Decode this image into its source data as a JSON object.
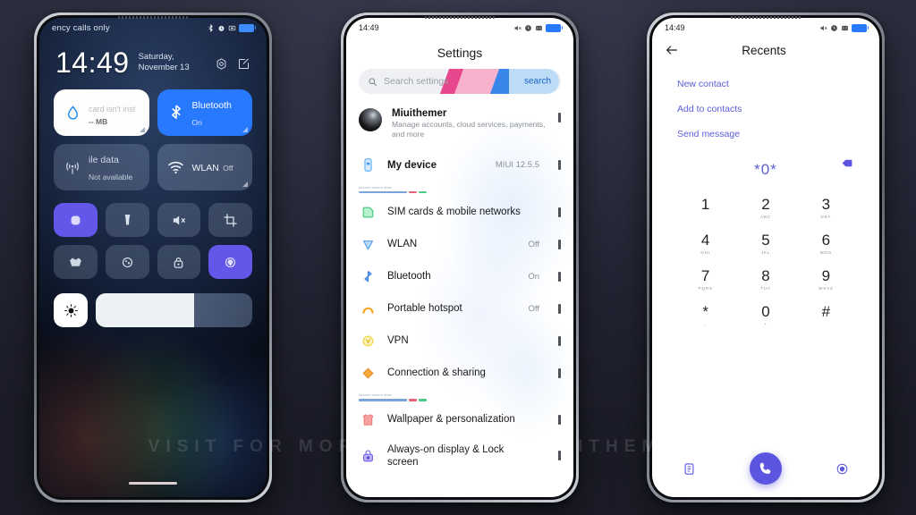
{
  "background_color": "#2a2b3c",
  "watermark": "VISIT FOR MORE THEMES - MIUITHEMER.COM",
  "phone1": {
    "name": "control-center",
    "statusbar": {
      "carrier": "ency calls only",
      "icons": [
        "bluetooth-icon",
        "alarm-icon",
        "silent-icon",
        "battery-icon"
      ]
    },
    "clock": {
      "time": "14:49",
      "date": "Saturday, November 13"
    },
    "clock_actions": [
      "settings-gear-icon",
      "edit-icon"
    ],
    "big_tiles": [
      {
        "title": "card isn't inst",
        "sub": "-- MB",
        "icon": "data-usage-drop-icon",
        "state": "white"
      },
      {
        "title": "Bluetooth",
        "sub": "On",
        "icon": "bluetooth-icon",
        "state": "on"
      },
      {
        "title": "ile data",
        "sub": "Not available",
        "icon": "mobile-signal-icon",
        "state": "off"
      },
      {
        "title": "WLAN",
        "sub": "Off",
        "icon": "wifi-icon",
        "state": "off"
      }
    ],
    "small_tiles": [
      {
        "icon": "dnd-icon",
        "on": true
      },
      {
        "icon": "flashlight-icon",
        "on": false
      },
      {
        "icon": "mute-icon",
        "on": false
      },
      {
        "icon": "screenshot-icon",
        "on": false
      },
      {
        "icon": "reading-mode-icon",
        "on": false
      },
      {
        "icon": "ultra-battery-icon",
        "on": false
      },
      {
        "icon": "lock-icon",
        "on": false
      },
      {
        "icon": "location-icon",
        "on": true
      }
    ],
    "brightness": {
      "icon": "auto-brightness-icon",
      "level_percent": 63
    }
  },
  "phone2": {
    "name": "settings",
    "statusbar": {
      "time": "14:49",
      "icons": [
        "silent-icon",
        "alarm-icon",
        "screenshot-icon",
        "battery-icon"
      ]
    },
    "title": "Settings",
    "search": {
      "placeholder": "Search settings",
      "icon": "search-icon",
      "badge": "search"
    },
    "account": {
      "name": "Miuithemer",
      "subtitle": "Manage accounts, cloud services, payments, and more",
      "avatar": "user-avatar"
    },
    "items": [
      {
        "label": "My device",
        "value": "MIUI 12.5.5",
        "icon": "phone-device-icon",
        "color": "#4ba3f5"
      },
      {
        "section": true,
        "label": "Internet secure ation"
      },
      {
        "label": "SIM cards & mobile networks",
        "value": "",
        "icon": "sim-card-icon",
        "color": "#44d07b"
      },
      {
        "label": "WLAN",
        "value": "Off",
        "icon": "wifi-shield-icon",
        "color": "#55a8f0"
      },
      {
        "label": "Bluetooth",
        "value": "On",
        "icon": "bluetooth-icon",
        "color": "#4a90f0"
      },
      {
        "label": "Portable hotspot",
        "value": "Off",
        "icon": "hotspot-icon",
        "color": "#f5a623"
      },
      {
        "label": "VPN",
        "value": "",
        "icon": "vpn-icon",
        "color": "#f2d13b"
      },
      {
        "label": "Connection & sharing",
        "value": "",
        "icon": "connection-share-icon",
        "color": "#f2921d"
      },
      {
        "section": true,
        "label": "Internet secure ation"
      },
      {
        "label": "Wallpaper & personalization",
        "value": "",
        "icon": "wallpaper-shirt-icon",
        "color": "#f07a7a"
      },
      {
        "label": "Always-on display & Lock screen",
        "value": "",
        "icon": "lock-aod-icon",
        "color": "#7b68ee"
      }
    ]
  },
  "phone3": {
    "name": "dialer-recents",
    "statusbar": {
      "time": "14:49",
      "icons": [
        "silent-icon",
        "alarm-icon",
        "screenshot-icon",
        "battery-icon"
      ]
    },
    "title": "Recents",
    "back_icon": "back-arrow-icon",
    "actions": [
      "New contact",
      "Add to contacts",
      "Send message"
    ],
    "dialed_number": "*0*",
    "backspace_icon": "backspace-icon",
    "keypad": [
      {
        "num": "1",
        "sub": ""
      },
      {
        "num": "2",
        "sub": "ABC"
      },
      {
        "num": "3",
        "sub": "DEF"
      },
      {
        "num": "4",
        "sub": "GHI"
      },
      {
        "num": "5",
        "sub": "JKL"
      },
      {
        "num": "6",
        "sub": "MNO"
      },
      {
        "num": "7",
        "sub": "PQRS"
      },
      {
        "num": "8",
        "sub": "TUV"
      },
      {
        "num": "9",
        "sub": "WXYZ"
      },
      {
        "num": "*",
        "sub": ","
      },
      {
        "num": "0",
        "sub": "+"
      },
      {
        "num": "#",
        "sub": ""
      }
    ],
    "bottom": {
      "left_icon": "contacts-list-icon",
      "call_icon": "call-icon",
      "right_icon": "shield-icon"
    },
    "accent_color": "#5b55e0"
  }
}
